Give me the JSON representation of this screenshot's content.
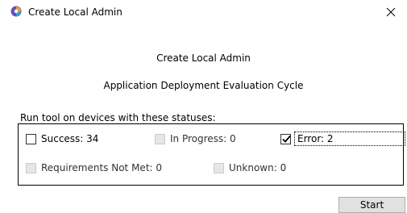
{
  "window": {
    "title": "Create Local Admin",
    "close_glyph": "×"
  },
  "header": {
    "title": "Create Local Admin",
    "subtitle": "Application Deployment Evaluation Cycle"
  },
  "prompt": "Run tool on devices with these statuses:",
  "statuses": [
    {
      "label": "Success: 34",
      "checked": false,
      "enabled": true
    },
    {
      "label": "In Progress: 0",
      "checked": false,
      "enabled": false
    },
    {
      "label": "Error: 2",
      "checked": true,
      "enabled": true,
      "focused": true
    },
    {
      "label": "Requirements Not Met: 0",
      "checked": false,
      "enabled": false
    },
    {
      "label": "Unknown: 0",
      "checked": false,
      "enabled": false
    }
  ],
  "buttons": {
    "start": "Start"
  },
  "icons": {
    "app": "app-logo-icon",
    "close": "close-icon",
    "check": "checkmark-icon"
  },
  "colors": {
    "background": "#ffffff",
    "border": "#000000",
    "disabled_box": "#e6e6e6",
    "button_bg": "#e1e1e1",
    "button_border": "#adadad"
  }
}
